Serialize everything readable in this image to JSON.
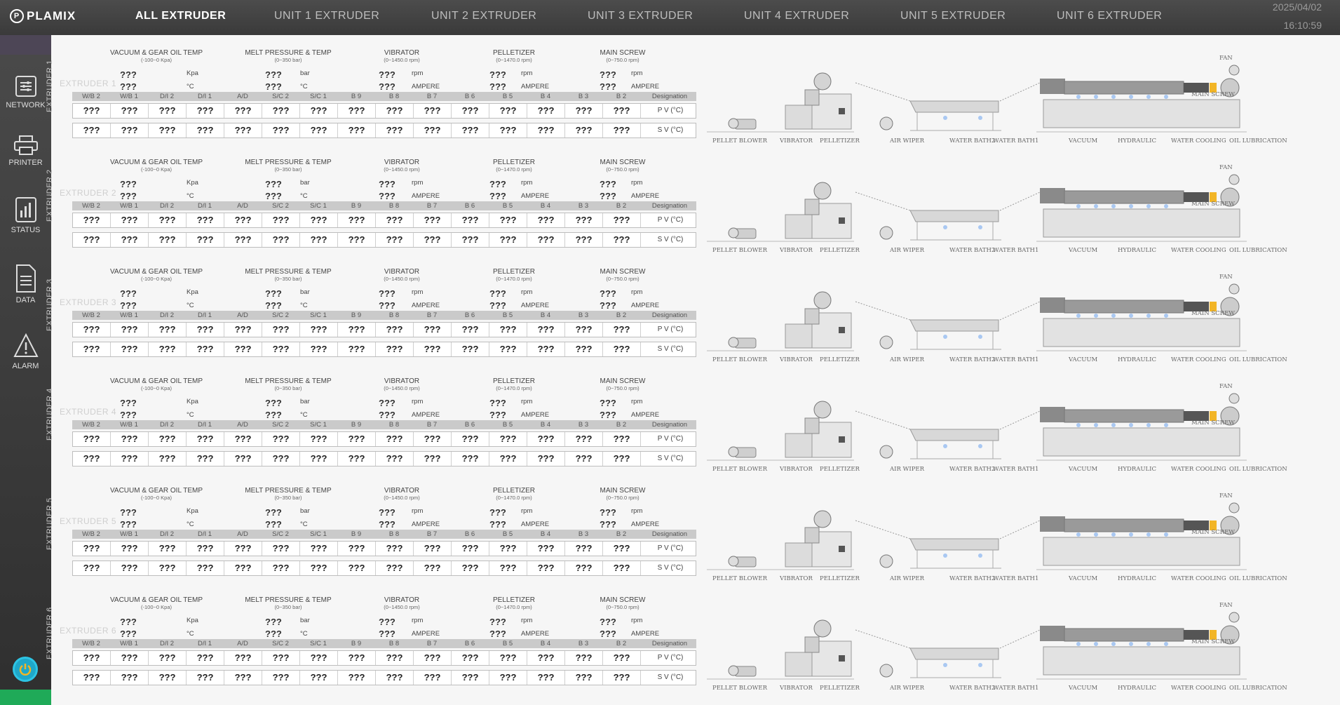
{
  "app": {
    "logo": "PLAMIX"
  },
  "tabs": [
    {
      "label": "ALL  EXTRUDER",
      "active": true
    },
    {
      "label": "UNIT 1  EXTRUDER",
      "active": false
    },
    {
      "label": "UNIT 2  EXTRUDER",
      "active": false
    },
    {
      "label": "UNIT 3  EXTRUDER",
      "active": false
    },
    {
      "label": "UNIT 4  EXTRUDER",
      "active": false
    },
    {
      "label": "UNIT 5  EXTRUDER",
      "active": false
    },
    {
      "label": "UNIT 6  EXTRUDER",
      "active": false
    }
  ],
  "datetime": {
    "date": "2025/04/02",
    "time": "16:10:59"
  },
  "sidebar": [
    {
      "label": "NETWORK",
      "icon": "network-icon"
    },
    {
      "label": "PRINTER",
      "icon": "printer-icon"
    },
    {
      "label": "STATUS",
      "icon": "status-icon"
    },
    {
      "label": "DATA",
      "icon": "data-icon"
    },
    {
      "label": "ALARM",
      "icon": "alarm-icon"
    }
  ],
  "groups": [
    {
      "title": "VACUUM & GEAR OIL TEMP",
      "range": "(-100~0 Kpa)",
      "unit1": "Kpa",
      "unit2": "°C"
    },
    {
      "title": "MELT  PRESSURE & TEMP",
      "range": "(0~350 bar)",
      "unit1": "bar",
      "unit2": "°C"
    },
    {
      "title": "VIBRATOR",
      "range": "(0~1450.0 rpm)",
      "unit1": "rpm",
      "unit2": "AMPERE"
    },
    {
      "title": "PELLETIZER",
      "range": "(0~1470.0 rpm)",
      "unit1": "rpm",
      "unit2": "AMPERE"
    },
    {
      "title": "MAIN SCREW",
      "range": "(0~750.0 rpm)",
      "unit1": "rpm",
      "unit2": "AMPERE"
    }
  ],
  "zones": [
    "W/B 2",
    "W/B 1",
    "D/I 2",
    "D/I 1",
    "A/D",
    "S/C 2",
    "S/C 1",
    "B 9",
    "B 8",
    "B 7",
    "B 6",
    "B 5",
    "B 4",
    "B 3",
    "B 2"
  ],
  "designation": {
    "header": "Designation",
    "pv": "P V (°C)",
    "sv": "S V (°C)"
  },
  "placeholder": "???",
  "machine_labels": [
    "PELLET BLOWER",
    "VIBRATOR",
    "PELLETIZER",
    "AIR WIPER",
    "WATER BATH2",
    "WATER BATH1",
    "VACUUM",
    "HYDRAULIC",
    "WATER COOLING",
    "OIL LUBRICATION"
  ],
  "machine_tags": {
    "fan": "FAN",
    "main_screw": "MAIN SCREW"
  },
  "extruders": [
    {
      "name": "EXTRUDER 1",
      "vertical": "EXTRUDER 1"
    },
    {
      "name": "EXTRUDER 2",
      "vertical": "EXTRUDER 2"
    },
    {
      "name": "EXTRUDER 3",
      "vertical": "EXTRUDER 3"
    },
    {
      "name": "EXTRUDER 4",
      "vertical": "EXTRUDER 4"
    },
    {
      "name": "EXTRUDER 5",
      "vertical": "EXTRUDER 5"
    },
    {
      "name": "EXTRUDER 6",
      "vertical": "EXTRUDER 6"
    }
  ],
  "colors": {
    "accent_green": "#1faa58",
    "power": "#1fa7c8",
    "header_bg": "#3f3f3f"
  }
}
